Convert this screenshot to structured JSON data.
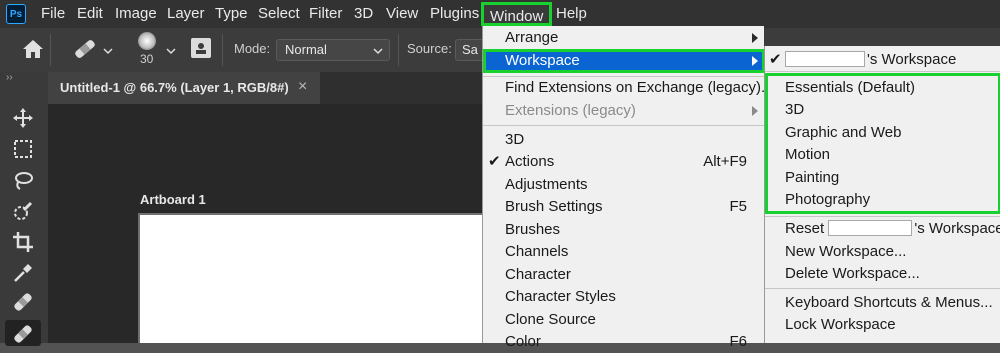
{
  "app": {
    "logo_text": "Ps"
  },
  "menubar": {
    "items": [
      "File",
      "Edit",
      "Image",
      "Layer",
      "Type",
      "Select",
      "Filter",
      "3D",
      "View",
      "Plugins",
      "Window",
      "Help"
    ]
  },
  "options": {
    "brush_size": "30",
    "mode_label": "Mode:",
    "mode_value": "Normal",
    "source_label": "Source:",
    "source_value": "Sa"
  },
  "document": {
    "tab_title": "Untitled-1 @ 66.7% (Layer 1, RGB/8#)",
    "close_glyph": "×",
    "artboard_label": "Artboard 1"
  },
  "window_menu": {
    "arrange": "Arrange",
    "workspace": "Workspace",
    "find_extensions": "Find Extensions on Exchange (legacy)...",
    "extensions": "Extensions (legacy)",
    "items": [
      {
        "label": "3D",
        "shortcut": ""
      },
      {
        "label": "Actions",
        "shortcut": "Alt+F9",
        "checked": "✔"
      },
      {
        "label": "Adjustments",
        "shortcut": ""
      },
      {
        "label": "Brush Settings",
        "shortcut": "F5"
      },
      {
        "label": "Brushes",
        "shortcut": ""
      },
      {
        "label": "Channels",
        "shortcut": ""
      },
      {
        "label": "Character",
        "shortcut": ""
      },
      {
        "label": "Character Styles",
        "shortcut": ""
      },
      {
        "label": "Clone Source",
        "shortcut": ""
      },
      {
        "label": "Color",
        "shortcut": "F6"
      }
    ]
  },
  "workspace_menu": {
    "current_check": "✔",
    "current_suffix": "'s Workspace",
    "presets": [
      "Essentials (Default)",
      "3D",
      "Graphic and Web",
      "Motion",
      "Painting",
      "Photography"
    ],
    "reset_prefix": "Reset",
    "reset_suffix": "'s Workspace",
    "new_workspace": "New Workspace...",
    "delete_workspace": "Delete Workspace...",
    "keyboard_shortcuts": "Keyboard Shortcuts & Menus...",
    "lock_workspace": "Lock Workspace"
  },
  "colors": {
    "highlight": "#0a64d2",
    "annotation_green": "#19d12e"
  }
}
